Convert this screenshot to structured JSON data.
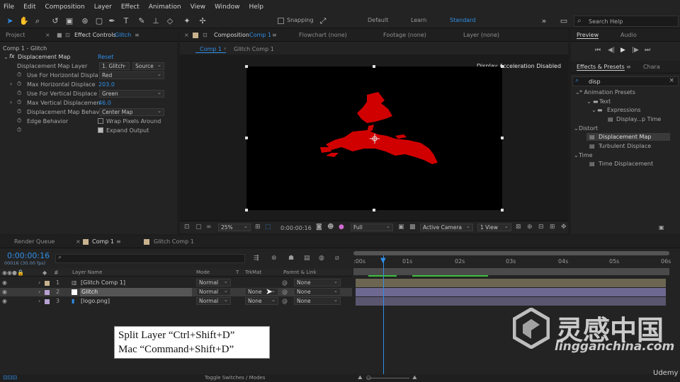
{
  "menu": [
    "File",
    "Edit",
    "Composition",
    "Layer",
    "Effect",
    "Animation",
    "View",
    "Window",
    "Help"
  ],
  "toolbar": {
    "snapping": "Snapping",
    "workspaces": [
      "Default",
      "Learn",
      "Standard"
    ],
    "active_workspace": "Standard",
    "search_placeholder": "Search Help"
  },
  "left_panel": {
    "tabs": [
      "Project",
      "Effect Controls",
      "Glitch"
    ],
    "breadcrumb": "Comp 1 - Glitch",
    "fx_label": "fx",
    "effect_name": "Displacement Map",
    "reset": "Reset",
    "props": [
      {
        "label": "Displacement Map Layer",
        "value": "1. Glitch",
        "value2": "Source"
      },
      {
        "label": "Use For Horizontal Displa",
        "value": "Red"
      },
      {
        "label": "Max Horizontal Displace",
        "value": "203.0"
      },
      {
        "label": "Use For Vertical Displace",
        "value": "Green"
      },
      {
        "label": "Max Vertical Displacemen",
        "value": "46.0"
      },
      {
        "label": "Displacement Map Behav",
        "value": "Center Map"
      },
      {
        "label": "Edge Behavior",
        "value": "Wrap Pixels Around"
      },
      {
        "label": "",
        "value": "Expand Output"
      }
    ]
  },
  "comp_panel": {
    "tabs": [
      "Composition",
      "Comp 1",
      "Flowchart (none)",
      "Footage (none)",
      "Layer (none)"
    ],
    "subtabs": [
      "Comp 1",
      "Glitch Comp 1"
    ],
    "accel_notice": "Display Acceleration Disabled",
    "zoom": "25%",
    "timecode": "0:00:00:16",
    "resolution": "Full",
    "camera": "Active Camera",
    "view": "1 View"
  },
  "right_panel": {
    "tabs": [
      "Preview",
      "Audio"
    ],
    "ep_tabs": [
      "Effects & Presets",
      "Chara"
    ],
    "search": "disp",
    "tree": [
      {
        "label": "* Animation Presets",
        "level": 0,
        "kind": "folder-open"
      },
      {
        "label": "Text",
        "level": 1,
        "kind": "folder-open"
      },
      {
        "label": "Expressions",
        "level": 2,
        "kind": "folder-open"
      },
      {
        "label": "Display...p Time",
        "level": 3,
        "kind": "effect"
      },
      {
        "label": "Distort",
        "level": 0,
        "kind": "folder-open"
      },
      {
        "label": "Displacement Map",
        "level": 1,
        "kind": "effect",
        "selected": true
      },
      {
        "label": "Turbulent Displace",
        "level": 1,
        "kind": "effect"
      },
      {
        "label": "Time",
        "level": 0,
        "kind": "folder-open"
      },
      {
        "label": "Time Displacement",
        "level": 1,
        "kind": "effect"
      }
    ]
  },
  "timeline": {
    "tabs": [
      "Render Queue",
      "Comp 1",
      "Glitch Comp 1"
    ],
    "timecode": "0:00:00:16",
    "frame_info": "00016 (30.00 fps)",
    "columns": [
      "Layer Name",
      "Mode",
      "T",
      "TrkMat",
      "Parent & Link"
    ],
    "ruler": [
      ":00s",
      "01s",
      "02s",
      "03s",
      "04s",
      "05s",
      "06s"
    ],
    "layers": [
      {
        "num": "1",
        "name": "[Glitch Comp 1]",
        "mode": "Normal",
        "trkmat": "",
        "parent": "None",
        "label_color": "#c9b28f"
      },
      {
        "num": "2",
        "name": "Glitch",
        "mode": "Normal",
        "trkmat": "None",
        "parent": "None",
        "label_color": "#b7a1d3"
      },
      {
        "num": "3",
        "name": "[logo.png]",
        "mode": "Normal",
        "trkmat": "None",
        "parent": "None",
        "label_color": "#b7a1d3"
      }
    ],
    "toggle": "Toggle Switches / Modes"
  },
  "caption": {
    "line1": "Split Layer “Ctrl+Shift+D”",
    "line2": "Mac “Command+Shift+D”"
  },
  "watermark": {
    "site": "lingganchina.com",
    "brand": "Udemy",
    "cn": "灵感中国"
  },
  "colors": {
    "accent": "#2f8fe8",
    "glitch_red": "#d10000",
    "layer_bar": "#6f6a8a",
    "comp_bar": "#8a8070"
  }
}
